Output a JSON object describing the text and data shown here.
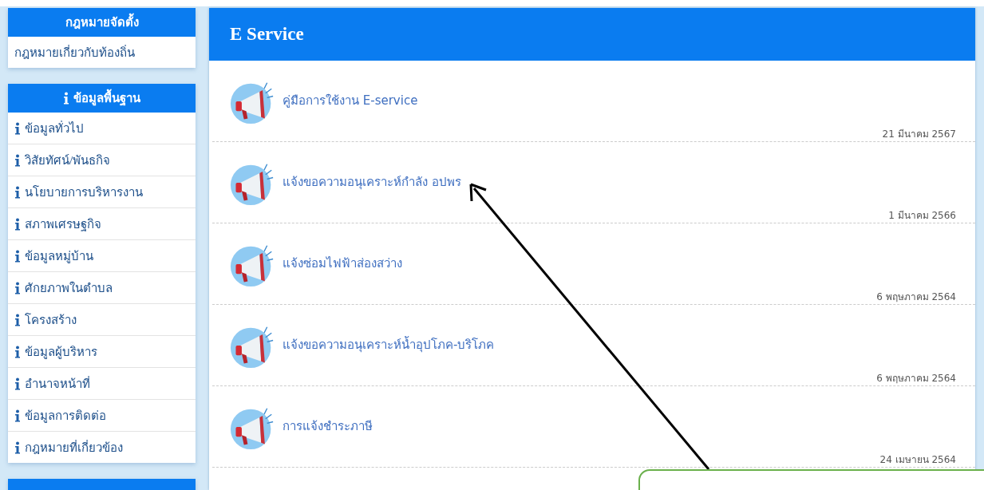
{
  "sidebar": [
    {
      "kind": "links",
      "title": "กฎหมายจัดตั้ง",
      "items": [
        "กฎหมายเกี่ยวกับท้องถิ่น"
      ]
    },
    {
      "kind": "info",
      "title": "ข้อมูลพื้นฐาน",
      "items": [
        "ข้อมูลทั่วไป",
        "วิสัยทัศน์/พันธกิจ",
        "นโยบายการบริหารงาน",
        "สภาพเศรษฐกิจ",
        "ข้อมูลหมู่บ้าน",
        "ศักยภาพในตำบล",
        "โครงสร้าง",
        "ข้อมูลผู้บริหาร",
        "อำนาจหน้าที่",
        "ข้อมูลการติดต่อ",
        "กฎหมายที่เกี่ยวข้อง"
      ]
    },
    {
      "kind": "info"
    }
  ],
  "panel": {
    "title": "E Service",
    "items": [
      {
        "title": "คู่มือการใช้งาน E-service",
        "date": "21 มีนาคม 2567"
      },
      {
        "title": "แจ้งขอความอนุเคราะห์กำลัง อปพร",
        "date": "1 มีนาคม 2566"
      },
      {
        "title": "แจ้งซ่อมไฟฟ้าส่องสว่าง",
        "date": "6 พฤษภาคม 2564"
      },
      {
        "title": "แจ้งขอความอนุเคราะห์น้ำอุปโภค-บริโภค",
        "date": "6 พฤษภาคม 2564"
      },
      {
        "title": "การแจ้งชำระภาษี",
        "date": "24 เมษายน 2564"
      }
    ]
  },
  "overlay": {
    "arrow": true,
    "callout": true
  }
}
